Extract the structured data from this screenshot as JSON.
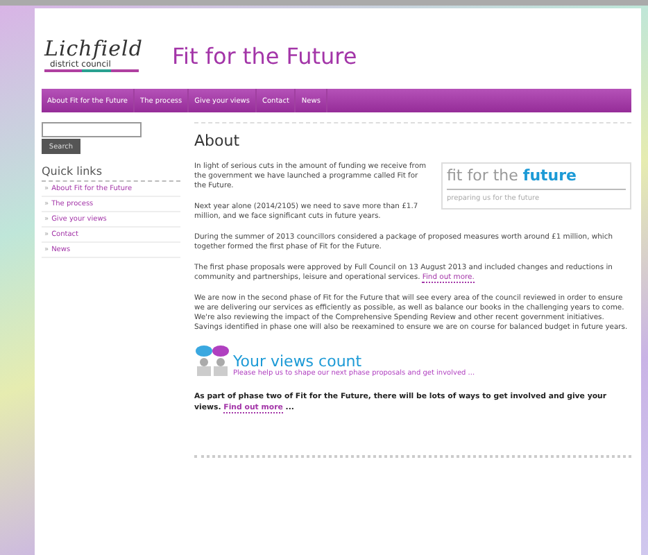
{
  "logo": {
    "script": "Lichfield",
    "subtitle": "district council"
  },
  "site_title": "Fit for the Future",
  "nav": [
    {
      "label": "About Fit for the Future"
    },
    {
      "label": "The process"
    },
    {
      "label": "Give your views"
    },
    {
      "label": "Contact"
    },
    {
      "label": "News"
    }
  ],
  "search": {
    "button": "Search"
  },
  "quick_links": {
    "title": "Quick links",
    "items": [
      {
        "bullet": "»",
        "label": "About Fit for the Future"
      },
      {
        "bullet": "»",
        "label": "The process"
      },
      {
        "bullet": "»",
        "label": "Give your views"
      },
      {
        "bullet": "»",
        "label": "Contact"
      },
      {
        "bullet": "»",
        "label": "News"
      }
    ]
  },
  "heading": "About",
  "banner": {
    "lead": "fit for the",
    "accent": "future",
    "tagline": "preparing us for the future"
  },
  "intro": [
    "In light of serious cuts in the amount of funding we receive from the government we have launched a programme called Fit for the Future.",
    "Next year alone (2014/2105) we need to save more than £1.7 million, and we face significant cuts in future years."
  ],
  "paragraphs": [
    {
      "text": "During the summer of 2013 councillors considered a package of proposed measures worth around £1 million, which together formed the first phase of Fit for the Future."
    },
    {
      "text": "The first phase proposals were approved by Full Council on 13 August 2013 and included changes and reductions in community and partnerships, leisure and operational services.",
      "link": "Find out more."
    },
    {
      "text": "We are now in the second phase of Fit for the Future that will see every area of the council reviewed in order to ensure we are delivering our services as efficiently as possible, as well as balance our books in the challenging years to come. We're also reviewing the impact of the Comprehensive Spending Review and other recent government initiatives. Savings identified in phase one will also be reexamined to ensure we are on course for balanced budget in future years."
    }
  ],
  "views": {
    "title": "Your views count",
    "subtitle": "Please help us to shape our next phase proposals and get involved ..."
  },
  "closing": {
    "text": "As part of phase two of Fit for the Future, there will be lots of ways to get involved and give your views.",
    "link": "Find out more",
    "tail": "..."
  }
}
